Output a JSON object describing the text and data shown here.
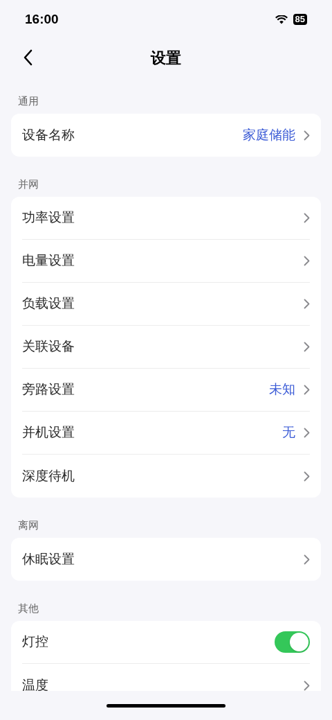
{
  "status_bar": {
    "time": "16:00",
    "battery": "85"
  },
  "nav": {
    "title": "设置"
  },
  "sections": [
    {
      "label": "通用",
      "rows": [
        {
          "kind": "nav",
          "label": "设备名称",
          "value": "家庭储能"
        }
      ]
    },
    {
      "label": "并网",
      "rows": [
        {
          "kind": "nav",
          "label": "功率设置"
        },
        {
          "kind": "nav",
          "label": "电量设置"
        },
        {
          "kind": "nav",
          "label": "负载设置"
        },
        {
          "kind": "nav",
          "label": "关联设备"
        },
        {
          "kind": "nav",
          "label": "旁路设置",
          "value": "未知"
        },
        {
          "kind": "nav",
          "label": "并机设置",
          "value": "无"
        },
        {
          "kind": "nav",
          "label": "深度待机"
        }
      ]
    },
    {
      "label": "离网",
      "rows": [
        {
          "kind": "nav",
          "label": "休眠设置"
        }
      ]
    },
    {
      "label": "其他",
      "rows": [
        {
          "kind": "toggle",
          "label": "灯控",
          "on": true
        },
        {
          "kind": "nav",
          "label": "温度"
        }
      ]
    }
  ]
}
